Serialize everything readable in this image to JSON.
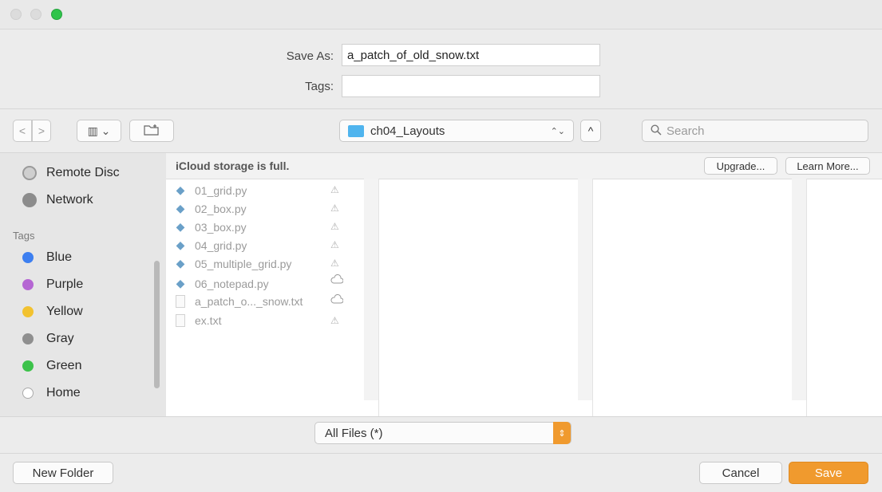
{
  "dialog": {
    "save_as_label": "Save As:",
    "save_as_value": "a_patch_of_old_snow.txt",
    "tags_label": "Tags:",
    "tags_value": ""
  },
  "toolbar": {
    "back_glyph": "<",
    "forward_glyph": ">",
    "view_glyph": "▥ ⌄",
    "new_folder_glyph": "⊞",
    "location": "ch04_Layouts",
    "location_chevron": "⌃⌄",
    "expand_glyph": "^",
    "search_placeholder": "Search"
  },
  "sidebar": {
    "items": [
      {
        "label": "Remote Disc",
        "icon": "disc-icon"
      },
      {
        "label": "Network",
        "icon": "globe-icon"
      }
    ],
    "tags_heading": "Tags",
    "tags": [
      {
        "label": "Blue",
        "color": "#3d7ff0"
      },
      {
        "label": "Purple",
        "color": "#b566d3"
      },
      {
        "label": "Yellow",
        "color": "#f2c230"
      },
      {
        "label": "Gray",
        "color": "#8f8f8f"
      },
      {
        "label": "Green",
        "color": "#3cc24a"
      },
      {
        "label": "Home",
        "color": "#ffffff"
      }
    ]
  },
  "browser": {
    "banner": "iCloud storage is full.",
    "upgrade_label": "Upgrade...",
    "learn_more_label": "Learn More...",
    "files": [
      {
        "name": "01_grid.py",
        "icon": "python-file-icon",
        "cloud": "cloud-warning-icon"
      },
      {
        "name": "02_box.py",
        "icon": "python-file-icon",
        "cloud": "cloud-warning-icon"
      },
      {
        "name": "03_box.py",
        "icon": "python-file-icon",
        "cloud": "cloud-warning-icon"
      },
      {
        "name": "04_grid.py",
        "icon": "python-file-icon",
        "cloud": "cloud-warning-icon"
      },
      {
        "name": "05_multiple_grid.py",
        "icon": "python-file-icon",
        "cloud": "cloud-warning-icon"
      },
      {
        "name": "06_notepad.py",
        "icon": "python-file-icon",
        "cloud": "cloud-icon"
      },
      {
        "name": "a_patch_o..._snow.txt",
        "icon": "text-file-icon",
        "cloud": "cloud-icon"
      },
      {
        "name": "ex.txt",
        "icon": "text-file-icon",
        "cloud": "cloud-warning-icon"
      }
    ]
  },
  "format": {
    "selected": "All Files (*)"
  },
  "footer": {
    "new_folder_label": "New Folder",
    "cancel_label": "Cancel",
    "save_label": "Save"
  },
  "colors": {
    "accent": "#f09a2e",
    "traffic_green": "#2fc44b",
    "folder_blue": "#4fb4ee"
  }
}
